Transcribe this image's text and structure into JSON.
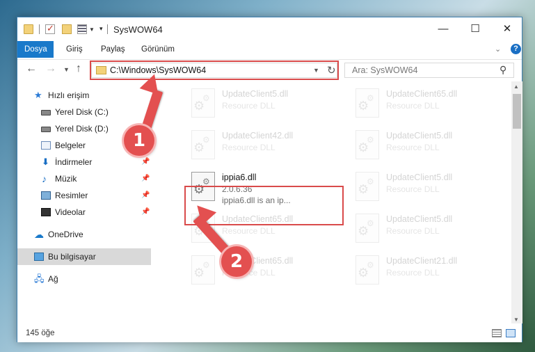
{
  "window": {
    "title": "SysWOW64",
    "min_glyph": "—",
    "max_glyph": "☐",
    "close_glyph": "✕"
  },
  "ribbon": {
    "tabs": [
      "Dosya",
      "Giriş",
      "Paylaş",
      "Görünüm"
    ],
    "help_glyph": "?"
  },
  "address": {
    "path": "C:\\Windows\\SysWOW64",
    "search_placeholder": "Ara: SysWOW64"
  },
  "sidebar": {
    "items": [
      {
        "label": "Hızlı erişim",
        "icon": "star-icon"
      },
      {
        "label": "Yerel Disk (C:)",
        "icon": "disk-icon"
      },
      {
        "label": "Yerel Disk (D:)",
        "icon": "disk-icon"
      },
      {
        "label": "Belgeler",
        "icon": "documents-icon"
      },
      {
        "label": "İndirmeler",
        "icon": "downloads-icon"
      },
      {
        "label": "Müzik",
        "icon": "music-icon"
      },
      {
        "label": "Resimler",
        "icon": "pictures-icon"
      },
      {
        "label": "Videolar",
        "icon": "videos-icon"
      },
      {
        "label": "OneDrive",
        "icon": "cloud-icon"
      },
      {
        "label": "Bu bilgisayar",
        "icon": "computer-icon"
      },
      {
        "label": "Ağ",
        "icon": "network-icon"
      }
    ]
  },
  "files": [
    {
      "name": "UpdateClient5.dll",
      "sub": "Resource DLL"
    },
    {
      "name": "UpdateClient65.dll",
      "sub": "Resource DLL"
    },
    {
      "name": "UpdateClient42.dll",
      "sub": "Resource DLL"
    },
    {
      "name": "UpdateClient5.dll",
      "sub": "Resource DLL"
    },
    {
      "name": "ippia6.dll",
      "version": "2.0.6.36",
      "sub": "ippia6.dll is an ip..."
    },
    {
      "name": "UpdateClient5.dll",
      "sub": "Resource DLL"
    },
    {
      "name": "UpdateClient65.dll",
      "sub": "Resource DLL"
    },
    {
      "name": "UpdateClient5.dll",
      "sub": "Resource DLL"
    },
    {
      "name": "UpdateClient65.dll",
      "sub": "Resource DLL"
    },
    {
      "name": "UpdateClient21.dll",
      "sub": "Resource DLL"
    }
  ],
  "status": {
    "count": "145 öğe"
  },
  "annotations": {
    "step1": "1",
    "step2": "2",
    "color": "#e35050"
  }
}
